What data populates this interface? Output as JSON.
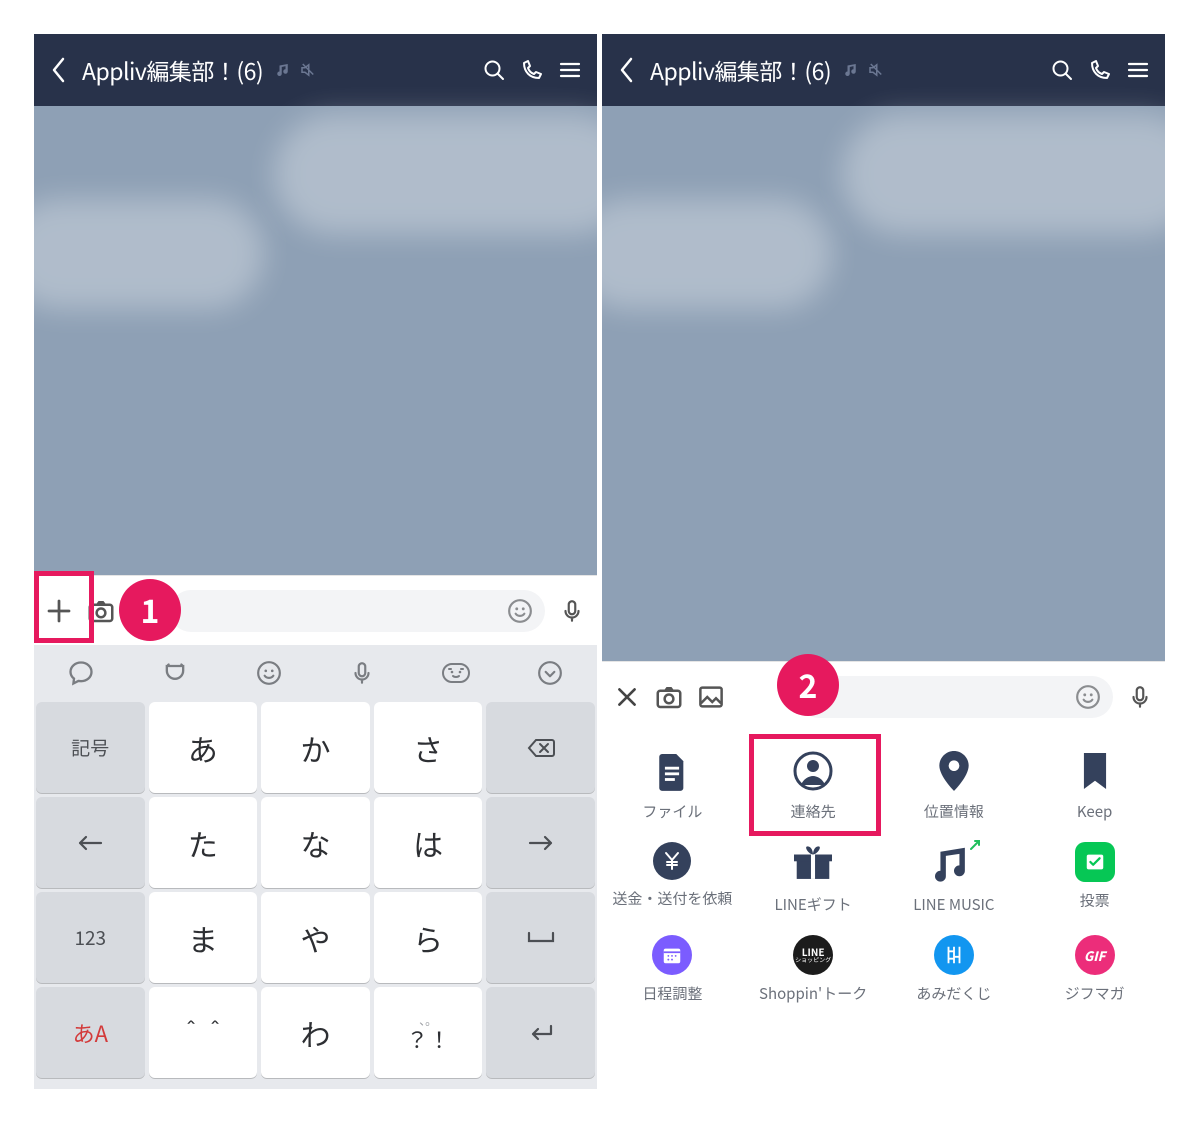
{
  "header": {
    "title": "Appliv編集部！(6)"
  },
  "badges": {
    "one": "1",
    "two": "2"
  },
  "kbd": {
    "symbol": "記号",
    "r1": [
      "あ",
      "か",
      "さ"
    ],
    "r2": [
      "た",
      "な",
      "は"
    ],
    "r3": [
      "ま",
      "や",
      "ら"
    ],
    "r4_eye": "＾＾",
    "r4_wa": "わ",
    "r4_punc_top": "、。",
    "r4_punc_bot": "？！",
    "num": "123",
    "mode": "あA"
  },
  "attach": {
    "items": [
      {
        "label": "ファイル"
      },
      {
        "label": "連絡先"
      },
      {
        "label": "位置情報"
      },
      {
        "label": "Keep"
      },
      {
        "label": "送金・送付を依頼"
      },
      {
        "label": "LINEギフト"
      },
      {
        "label": "LINE MUSIC"
      },
      {
        "label": "投票"
      },
      {
        "label": "日程調整"
      },
      {
        "label": "Shoppin'トーク"
      },
      {
        "label": "あみだくじ"
      },
      {
        "label": "ジフマガ"
      }
    ],
    "line_shopping_top": "LINE",
    "line_shopping_bot": "ショッピング",
    "gif": "GIF"
  }
}
